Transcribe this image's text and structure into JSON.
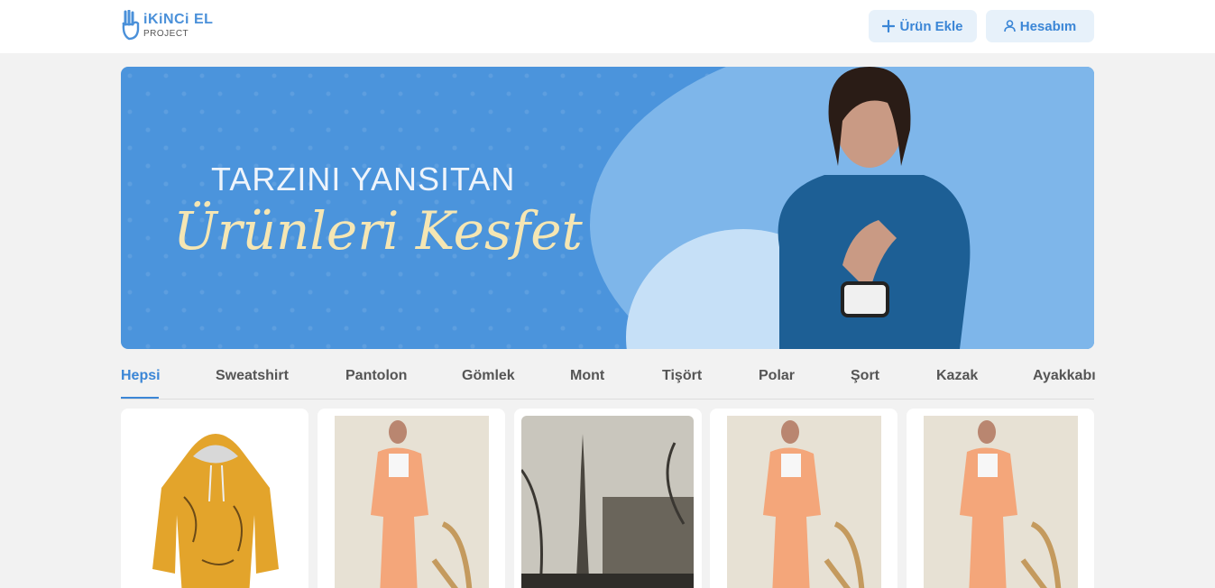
{
  "header": {
    "logo": {
      "name": "iKiNCi EL",
      "sub": "PROJECT"
    },
    "add_button": "Ürün Ekle",
    "account_button": "Hesabım"
  },
  "banner": {
    "headline": "TARZINI YANSITAN",
    "script": "Ürünleri Kesfet"
  },
  "tabs": [
    "Hepsi",
    "Sweatshirt",
    "Pantolon",
    "Gömlek",
    "Mont",
    "Tişört",
    "Polar",
    "Şort",
    "Kazak",
    "Ayakkabı"
  ],
  "active_tab": "Hepsi",
  "products": [
    {
      "image": "hoodie-map-print"
    },
    {
      "image": "orange-suit-model"
    },
    {
      "image": "eiffel-tower-photo"
    },
    {
      "image": "orange-suit-model"
    },
    {
      "image": "orange-suit-model"
    }
  ],
  "colors": {
    "accent": "#3b86d6",
    "button_bg": "#e7f1fa",
    "banner_blue": "#4b94dc"
  }
}
